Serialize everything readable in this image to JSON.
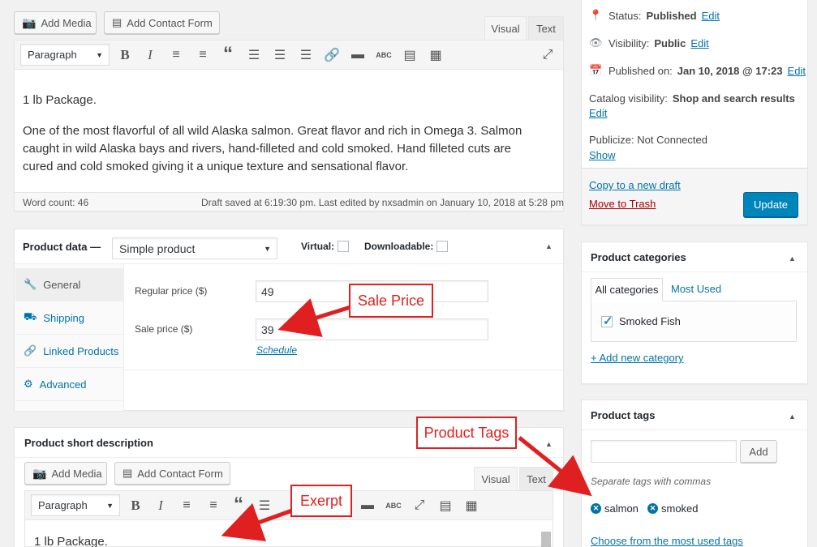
{
  "editor": {
    "add_media": "Add Media",
    "add_contact_form": "Add Contact Form",
    "tab_visual": "Visual",
    "tab_text": "Text",
    "format_select": "Paragraph",
    "paragraph1": "1 lb Package.",
    "paragraph2_line1": "One of the most flavorful of all wild Alaska salmon. Great flavor and rich in Omega 3. Salmon",
    "paragraph2_line2": "caught in wild Alaska bays and rivers, hand-filleted and cold smoked. Hand filleted cuts are",
    "paragraph2_line3": "cured and cold smoked giving it a unique texture and sensational flavor.",
    "word_count": "Word count: 46",
    "draft_status": "Draft saved at 6:19:30 pm. Last edited by nxsadmin on January 10, 2018 at 5:28 pm"
  },
  "product_data": {
    "title": "Product data —",
    "type_select": "Simple product",
    "virtual_label": "Virtual:",
    "downloadable_label": "Downloadable:",
    "tabs": [
      {
        "label": "General",
        "icon": "wrench-icon"
      },
      {
        "label": "Shipping",
        "icon": "truck-icon"
      },
      {
        "label": "Linked Products",
        "icon": "link-icon"
      },
      {
        "label": "Advanced",
        "icon": "gear-icon"
      }
    ],
    "regular_price_label": "Regular price ($)",
    "regular_price_value": "49",
    "sale_price_label": "Sale price ($)",
    "sale_price_value": "39",
    "schedule_link": "Schedule"
  },
  "short_description": {
    "title": "Product short description",
    "add_media": "Add Media",
    "add_contact_form": "Add Contact Form",
    "tab_visual": "Visual",
    "tab_text": "Text",
    "format_select": "Paragraph",
    "content": "1 lb Package."
  },
  "publish": {
    "status_label": "Status:",
    "status_value": "Published",
    "visibility_label": "Visibility:",
    "visibility_value": "Public",
    "published_label": "Published on:",
    "published_value": "Jan 10, 2018 @ 17:23",
    "edit": "Edit",
    "catalog_label": "Catalog visibility:",
    "catalog_value": "Shop and search results",
    "publicize_label": "Publicize: Not Connected",
    "show": "Show",
    "copy_draft": "Copy to a new draft",
    "move_trash": "Move to Trash",
    "update": "Update"
  },
  "categories": {
    "title": "Product categories",
    "tab_all": "All categories",
    "tab_most_used": "Most Used",
    "item": "Smoked Fish",
    "add_new": "+ Add new category"
  },
  "tags": {
    "title": "Product tags",
    "add_button": "Add",
    "hint": "Separate tags with commas",
    "items": [
      "salmon",
      "smoked"
    ],
    "choose_link": "Choose from the most used tags"
  },
  "callouts": {
    "sale_price": "Sale Price",
    "product_tags": "Product Tags",
    "exerpt": "Exerpt"
  },
  "colors": {
    "link": "#0073aa",
    "update_button": "#0085ba",
    "trash": "#a00",
    "callout": "#e02020"
  }
}
